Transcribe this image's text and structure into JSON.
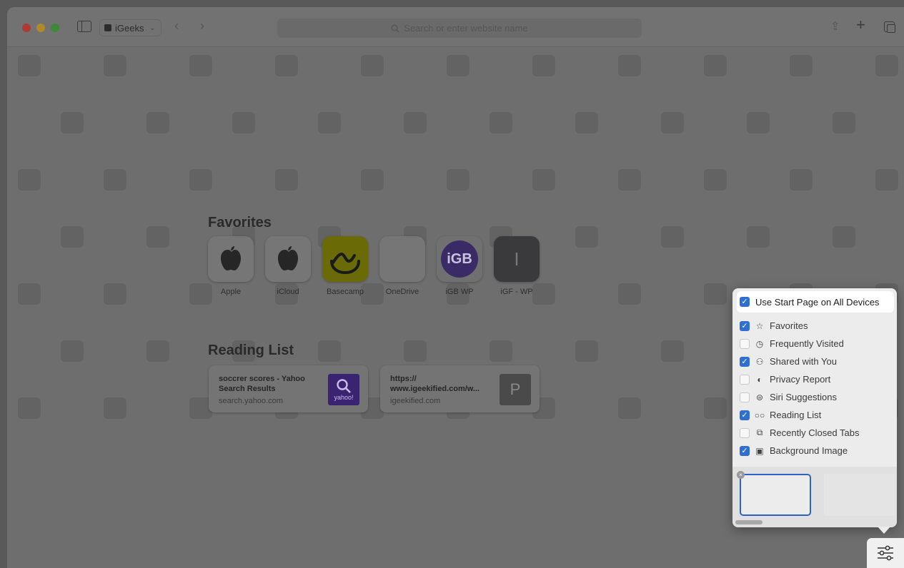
{
  "toolbar": {
    "tab_group": "iGeeks",
    "address_placeholder": "Search or enter website name"
  },
  "favorites": {
    "title": "Favorites",
    "items": [
      {
        "label": "Apple",
        "icon": "apple-logo-icon"
      },
      {
        "label": "iCloud",
        "icon": "apple-logo-icon"
      },
      {
        "label": "Basecamp",
        "icon": "basecamp-logo-icon"
      },
      {
        "label": "OneDrive",
        "icon": "blank-icon"
      },
      {
        "label": "iGB WP",
        "icon": "igb-logo-icon",
        "glyph": "iGB"
      },
      {
        "label": "iGF - WP",
        "icon": "letter-tile-icon",
        "glyph": "I"
      }
    ]
  },
  "reading_list": {
    "title": "Reading List",
    "items": [
      {
        "title": "soccrer scores - Yahoo Search Results",
        "domain": "search.yahoo.com",
        "thumb": "yahoo!"
      },
      {
        "title": "https:// www.igeekified.com/w...",
        "domain": "igeekified.com",
        "thumb": "P"
      }
    ]
  },
  "popover": {
    "use_start_page": {
      "label": "Use Start Page on All Devices",
      "checked": true
    },
    "items": [
      {
        "label": "Favorites",
        "checked": true,
        "icon": "star-icon"
      },
      {
        "label": "Frequently Visited",
        "checked": false,
        "icon": "clock-icon"
      },
      {
        "label": "Shared with You",
        "checked": true,
        "icon": "people-icon"
      },
      {
        "label": "Privacy Report",
        "checked": false,
        "icon": "shield-icon"
      },
      {
        "label": "Siri Suggestions",
        "checked": false,
        "icon": "siri-icon"
      },
      {
        "label": "Reading List",
        "checked": true,
        "icon": "glasses-icon"
      },
      {
        "label": "Recently Closed Tabs",
        "checked": false,
        "icon": "tabs-icon"
      },
      {
        "label": "Background Image",
        "checked": true,
        "icon": "image-icon"
      }
    ]
  },
  "colors": {
    "accent": "#2f6fd1",
    "dimmed_background": "#595959"
  }
}
